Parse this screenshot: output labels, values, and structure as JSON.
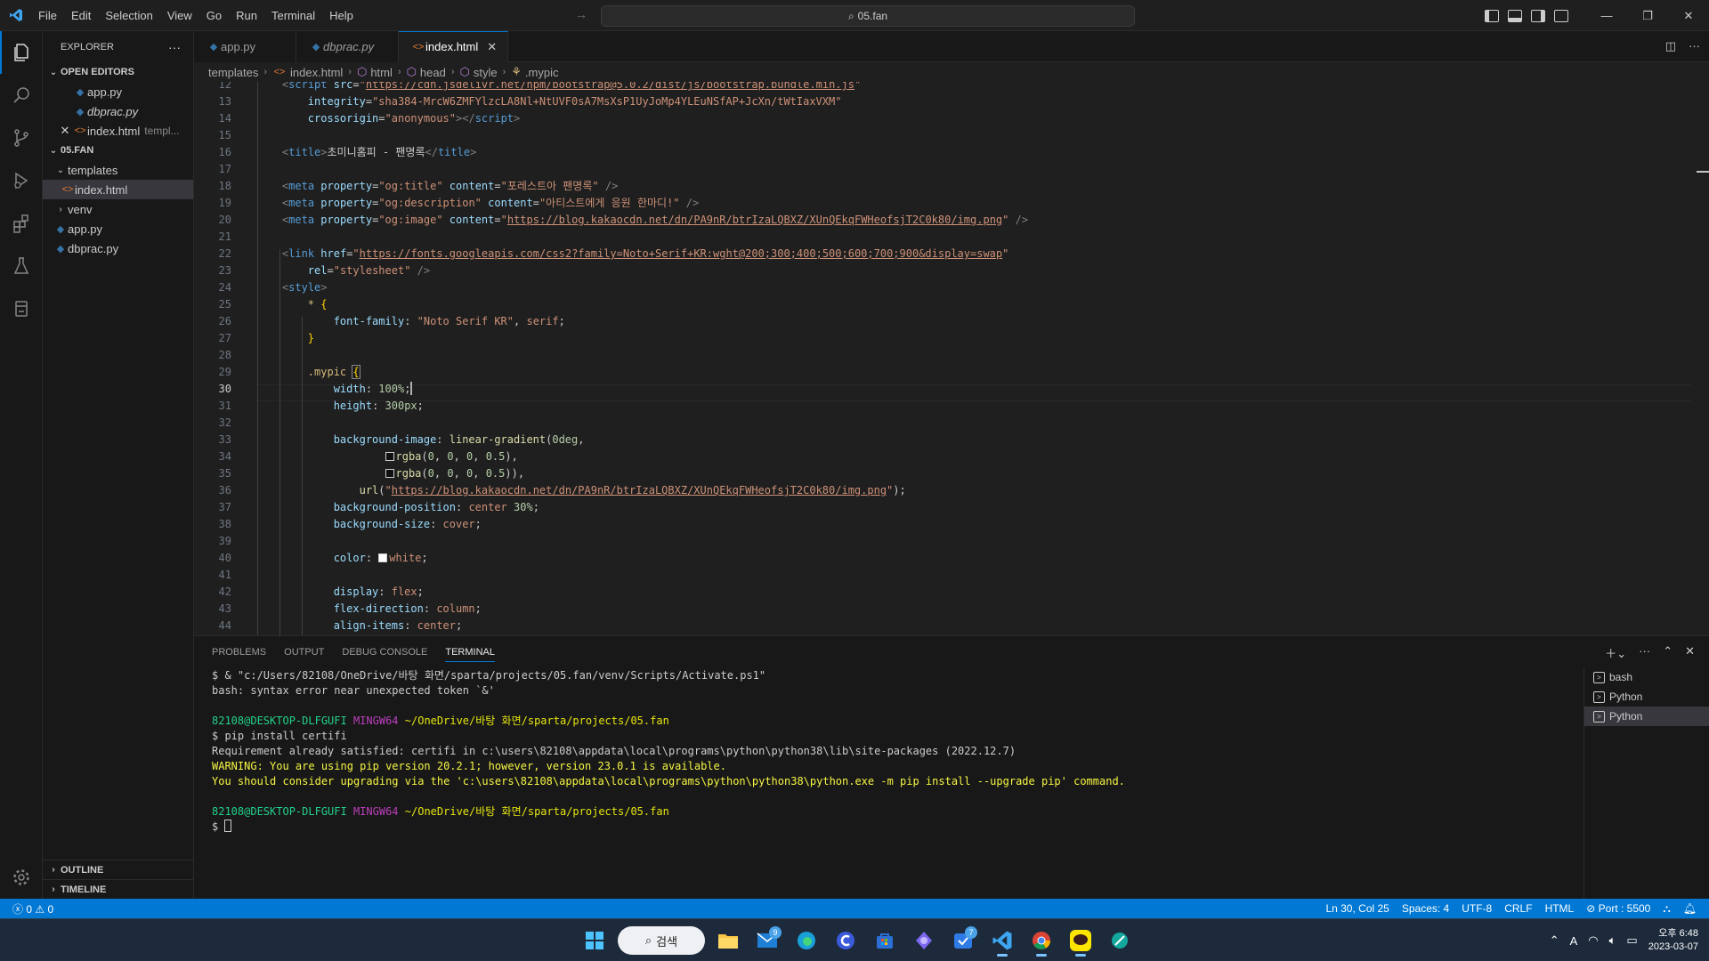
{
  "titlebar": {
    "menu": [
      "File",
      "Edit",
      "Selection",
      "View",
      "Go",
      "Run",
      "Terminal",
      "Help"
    ],
    "search": "05.fan"
  },
  "sidebar": {
    "title": "EXPLORER",
    "open_editors_label": "OPEN EDITORS",
    "open_editors": [
      {
        "name": "app.py",
        "type": "py"
      },
      {
        "name": "dbprac.py",
        "type": "py"
      },
      {
        "name": "index.html",
        "type": "html",
        "hint": "templ..."
      }
    ],
    "folder_label": "05.FAN",
    "tree": {
      "templates": "templates",
      "index": "index.html",
      "venv": "venv",
      "app": "app.py",
      "dbprac": "dbprac.py"
    },
    "outline": "OUTLINE",
    "timeline": "TIMELINE"
  },
  "tabs": [
    "app.py",
    "dbprac.py",
    "index.html"
  ],
  "breadcrumb": [
    "templates",
    "index.html",
    "html",
    "head",
    "style",
    ".mypic"
  ],
  "editor": {
    "first_line": 12,
    "current_line": 30
  },
  "panel": {
    "tabs": [
      "PROBLEMS",
      "OUTPUT",
      "DEBUG CONSOLE",
      "TERMINAL"
    ],
    "terminal": {
      "l1": "$ & \"c:/Users/82108/OneDrive/바탕 화면/sparta/projects/05.fan/venv/Scripts/Activate.ps1\"",
      "l2": "bash: syntax error near unexpected token `&'",
      "user1": "82108@DESKTOP-DLFGUFI",
      "env1": "MINGW64",
      "path1": "~/OneDrive/바탕 화면/sparta/projects/05.fan",
      "cmd": "$ pip install certifi",
      "req": "Requirement already satisfied: certifi in c:\\users\\82108\\appdata\\local\\programs\\python\\python38\\lib\\site-packages (2022.12.7)",
      "warn1": "WARNING: You are using pip version 20.2.1; however, version 23.0.1 is available.",
      "warn2": "You should consider upgrading via the 'c:\\users\\82108\\appdata\\local\\programs\\python\\python38\\python.exe -m pip install --upgrade pip' command.",
      "prompt": "$ "
    },
    "terminals": [
      "bash",
      "Python",
      "Python"
    ]
  },
  "statusbar": {
    "errors": "0",
    "warnings": "0",
    "position": "Ln 30, Col 25",
    "spaces": "Spaces: 4",
    "encoding": "UTF-8",
    "eol": "CRLF",
    "language": "HTML",
    "port": "Port : 5500"
  },
  "taskbar": {
    "search": "검색",
    "mail_badge": "9",
    "todo_badge": "7",
    "lang": "A",
    "time": "오후 6:48",
    "date": "2023-03-07"
  },
  "colors": {
    "accent": "#0078d4",
    "editor_bg": "#1f1f1f",
    "sidebar_bg": "#181818"
  }
}
